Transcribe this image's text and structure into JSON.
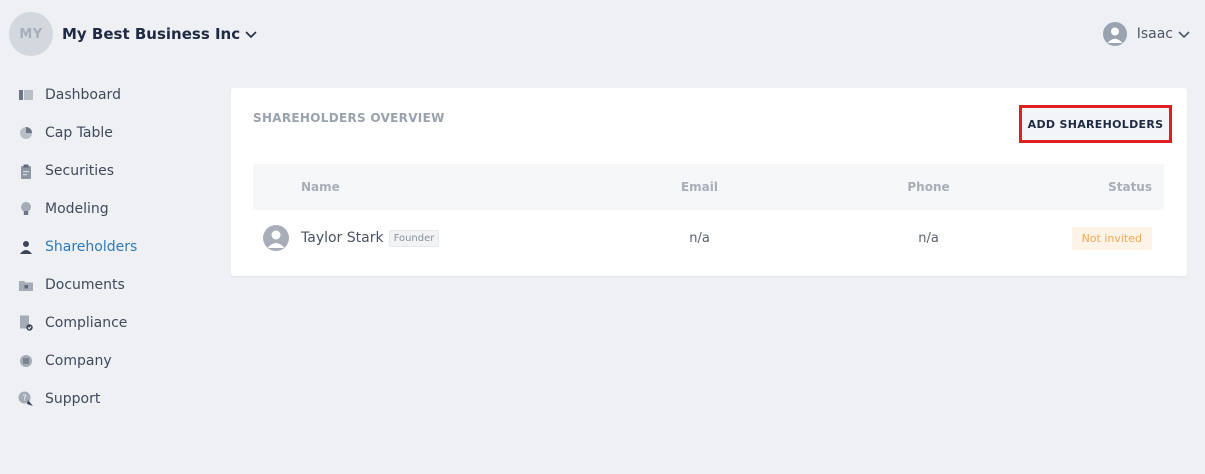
{
  "header": {
    "company_initials": "MY",
    "company_name": "My Best Business Inc",
    "user_name": "Isaac"
  },
  "sidebar": {
    "items": [
      {
        "label": "Dashboard",
        "icon": "dashboard-icon"
      },
      {
        "label": "Cap Table",
        "icon": "pie-chart-icon"
      },
      {
        "label": "Securities",
        "icon": "clipboard-icon"
      },
      {
        "label": "Modeling",
        "icon": "lightbulb-icon"
      },
      {
        "label": "Shareholders",
        "icon": "person-icon",
        "active": true
      },
      {
        "label": "Documents",
        "icon": "folder-lock-icon"
      },
      {
        "label": "Compliance",
        "icon": "document-check-icon"
      },
      {
        "label": "Company",
        "icon": "building-icon"
      },
      {
        "label": "Support",
        "icon": "help-chat-icon"
      }
    ]
  },
  "main": {
    "title": "SHAREHOLDERS OVERVIEW",
    "add_button_label": "ADD SHAREHOLDERS",
    "table": {
      "columns": [
        "Name",
        "Email",
        "Phone",
        "Status"
      ],
      "rows": [
        {
          "name": "Taylor Stark",
          "role": "Founder",
          "email": "n/a",
          "phone": "n/a",
          "status": "Not invited"
        }
      ]
    }
  },
  "colors": {
    "accent": "#2e7ab8",
    "highlight_border": "#e01e26",
    "status_warning": "#f0a955",
    "background": "#eef0f4"
  }
}
